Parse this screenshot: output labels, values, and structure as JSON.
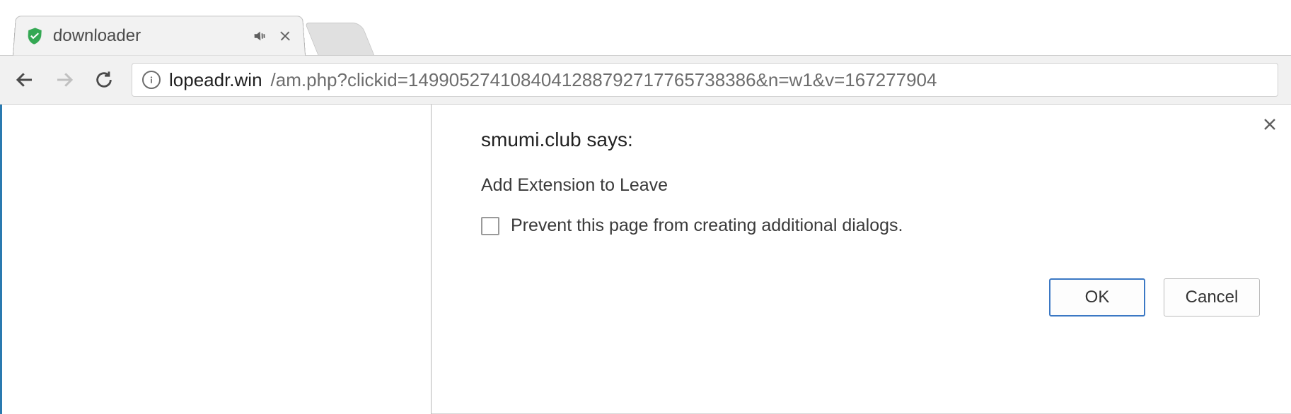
{
  "tab": {
    "title": "downloader",
    "favicon": "shield-check"
  },
  "url": {
    "host": "lopeadr.win",
    "path": "/am.php?clickid=149905274108404128879271776573838­6&n=w1&v=167277904"
  },
  "dialog": {
    "origin": "smumi.club says:",
    "message": "Add Extension to Leave",
    "prevent_label": "Prevent this page from creating additional dialogs.",
    "ok_label": "OK",
    "cancel_label": "Cancel"
  }
}
